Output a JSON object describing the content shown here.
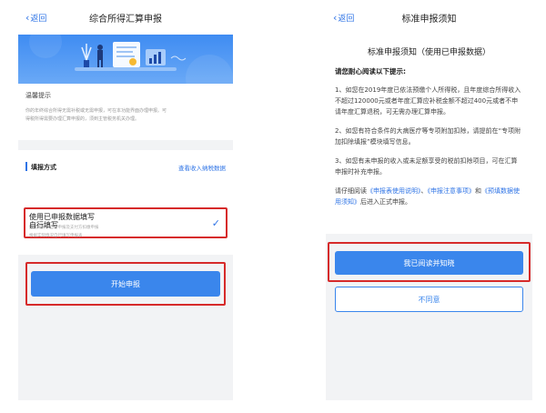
{
  "left": {
    "back_label": "返回",
    "title": "综合所得汇算申报",
    "notice": {
      "title": "温馨提示",
      "line1": "你的年终综合所得无需补税或无需申报，可在本功能界面办理申报。可",
      "line2": "得税所得需要办理汇算申报的，须到主管税务机关办理。"
    },
    "method": {
      "label": "填报方式",
      "link": "查看收入纳税数据"
    },
    "options": [
      {
        "title": "使用已申报数据填写",
        "subtitle": "数据来源于自行申报及支付方扣缴申报",
        "selected": true
      },
      {
        "title": "自行填写",
        "subtitle": "根据实际情况自行填写申报表",
        "selected": false
      }
    ],
    "start_button": "开始申报"
  },
  "right": {
    "back_label": "返回",
    "title": "标准申报须知",
    "card_title": "标准申报须知（使用已申报数据）",
    "subtitle": "请您耐心阅读以下提示:",
    "para1": "1、如您在2019年度已依法预缴个人所得税，且年度综合所得收入不超过120000元或者年度汇算应补税金额不超过400元或者不申请年度汇算退税，可无需办理汇算申报。",
    "para2": "2、如您有符合条件的大病医疗等专项附加扣除，请提前在“专项附加扣除填报”模块填写信息。",
    "para3": "3、如您有未申报的收入或未足额享受的税前扣除项目，可在汇算申报时补充申报。",
    "para4": {
      "before": "请仔细阅读",
      "link1": "《申报表使用说明》",
      "sep1": "、",
      "link2": "《申报注意事项》",
      "sep2": "和",
      "link3": "《预填数据使用须知》",
      "after": "后进入正式申报。"
    },
    "agree_button": "我已阅读并知晓",
    "disagree_button": "不同意"
  },
  "colors": {
    "accent": "#3a86ec",
    "highlight": "#d62a2a",
    "background": "#f2f3f5"
  }
}
